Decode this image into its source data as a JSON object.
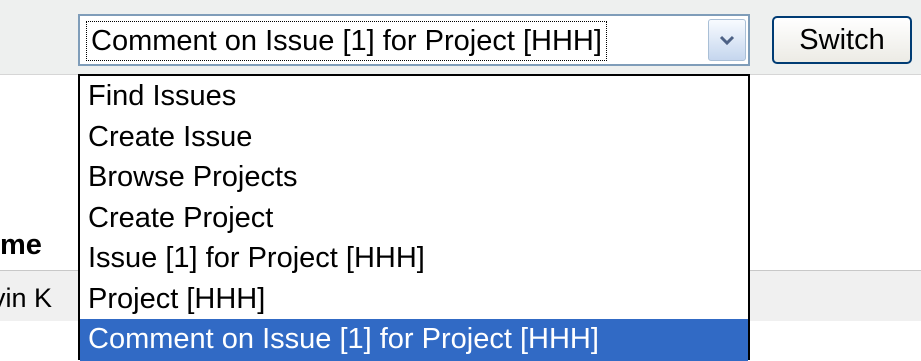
{
  "selector": {
    "current_value": "Comment on Issue [1] for Project [HHH]",
    "switch_label": "Switch",
    "options": [
      "Find Issues",
      "Create Issue",
      "Browse Projects",
      "Create Project",
      "Issue [1] for Project [HHH]",
      "Project [HHH]",
      "Comment on Issue [1] for Project [HHH]"
    ],
    "selected_index": 6,
    "arrow_icon": "chevron-down-icon"
  },
  "background": {
    "heading_fragment": "me",
    "cell_fragment": "vin K"
  },
  "colors": {
    "selection_highlight": "#316ac5",
    "select_border": "#7f9db9",
    "button_border": "#003c74",
    "toolbar_bg": "#eef0ef"
  }
}
